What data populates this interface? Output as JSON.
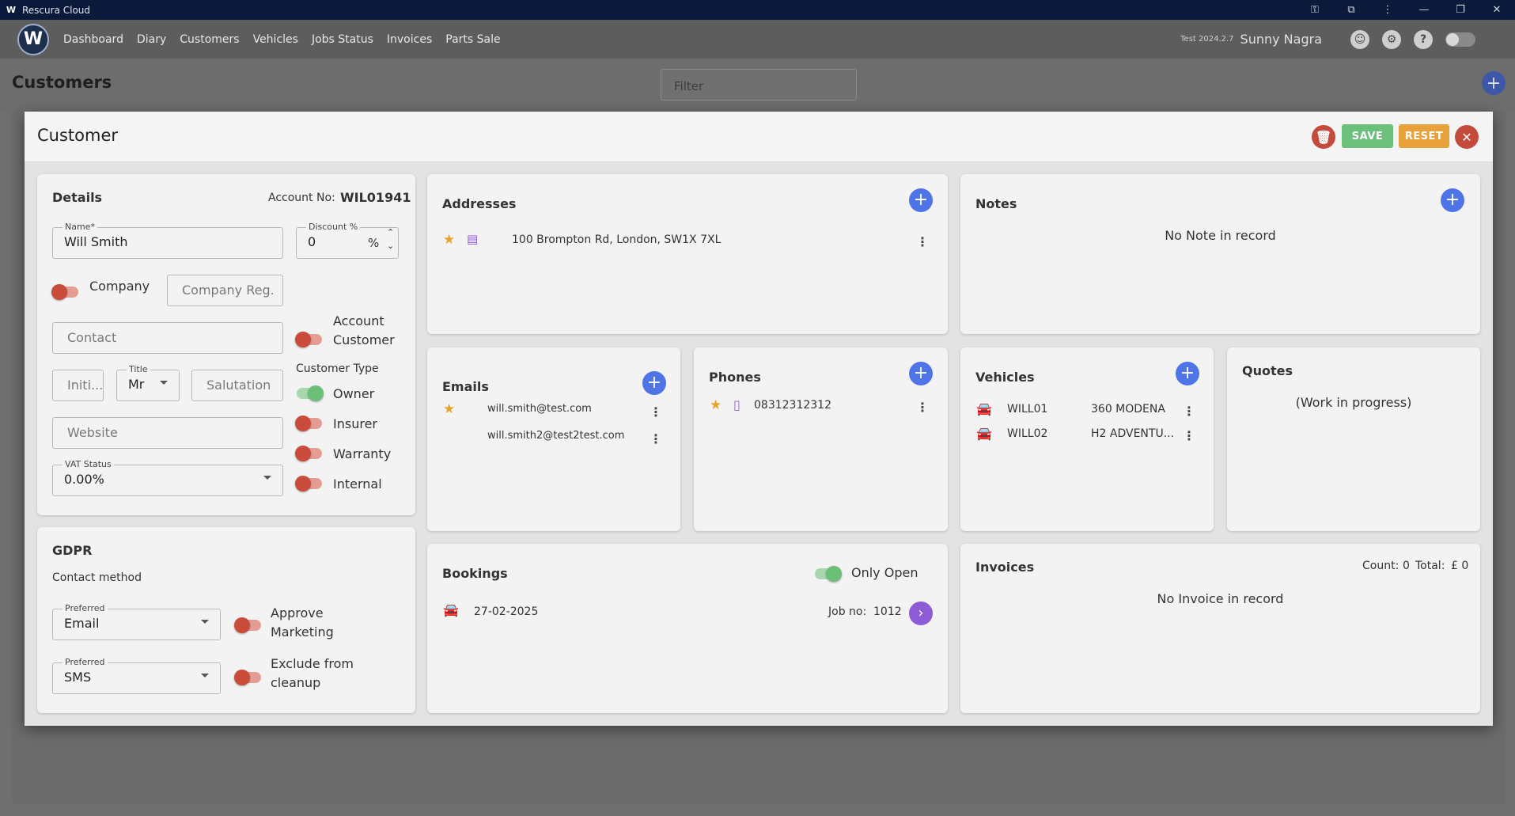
{
  "window": {
    "app_title": "Rescura Cloud",
    "logo_letter": "W"
  },
  "nav": {
    "items": [
      "Dashboard",
      "Diary",
      "Customers",
      "Vehicles",
      "Jobs Status",
      "Invoices",
      "Parts Sale"
    ],
    "version": "Test 2024.2.7",
    "username": "Sunny Nagra"
  },
  "page": {
    "title": "Customers",
    "filter_placeholder": "Filter"
  },
  "dialog": {
    "title": "Customer",
    "save_label": "SAVE",
    "reset_label": "RESET"
  },
  "details": {
    "title": "Details",
    "account_label": "Account No:",
    "account_no": "WIL01941",
    "name_label": "Name*",
    "name_value": "Will Smith",
    "discount_label": "Discount %",
    "discount_value": "0",
    "discount_unit": "%",
    "company_label": "Company",
    "company_on": false,
    "company_reg_placeholder": "Company Reg.",
    "contact_placeholder": "Contact",
    "account_customer_label_1": "Account",
    "account_customer_label_2": "Customer",
    "account_customer_on": false,
    "initials_placeholder": "Initi...",
    "title_label": "Title",
    "title_value": "Mr",
    "salutation_placeholder": "Salutation",
    "customer_type_label": "Customer Type",
    "customer_types": [
      {
        "label": "Owner",
        "on": true
      },
      {
        "label": "Insurer",
        "on": false
      },
      {
        "label": "Warranty",
        "on": false
      },
      {
        "label": "Internal",
        "on": false
      }
    ],
    "website_placeholder": "Website",
    "vat_label": "VAT Status",
    "vat_value": "0.00%"
  },
  "gdpr": {
    "title": "GDPR",
    "contact_method_label": "Contact method",
    "preferred_label": "Preferred",
    "preferred_1": "Email",
    "preferred_2": "SMS",
    "approve_marketing_1": "Approve",
    "approve_marketing_2": "Marketing",
    "exclude_cleanup_1": "Exclude from",
    "exclude_cleanup_2": "cleanup"
  },
  "addresses": {
    "title": "Addresses",
    "items": [
      "100 Brompton Rd, London, SW1X 7XL"
    ]
  },
  "notes": {
    "title": "Notes",
    "empty": "No Note in record"
  },
  "emails": {
    "title": "Emails",
    "items": [
      "will.smith@test.com",
      "will.smith2@test2test.com"
    ]
  },
  "phones": {
    "title": "Phones",
    "items": [
      "08312312312"
    ]
  },
  "vehicles": {
    "title": "Vehicles",
    "items": [
      {
        "reg": "WILL01",
        "model": "360 MODENA"
      },
      {
        "reg": "WILL02",
        "model": "H2 ADVENTU..."
      }
    ]
  },
  "quotes": {
    "title": "Quotes",
    "status": "(Work in progress)"
  },
  "bookings": {
    "title": "Bookings",
    "only_open_label": "Only Open",
    "only_open_on": true,
    "items": [
      {
        "date": "27-02-2025",
        "job_label": "Job no:",
        "job_no": "1012"
      }
    ]
  },
  "invoices": {
    "title": "Invoices",
    "count_label": "Count:",
    "count": "0",
    "total_label": "Total:",
    "total": "£ 0",
    "empty": "No Invoice in record"
  },
  "colors": {
    "accent_blue": "#4f74e8",
    "save_green": "#6cc07c",
    "reset_orange": "#e9a23b",
    "delete_red": "#c44a3c",
    "star_gold": "#e9a32a",
    "booking_purple": "#8e5bd6"
  }
}
